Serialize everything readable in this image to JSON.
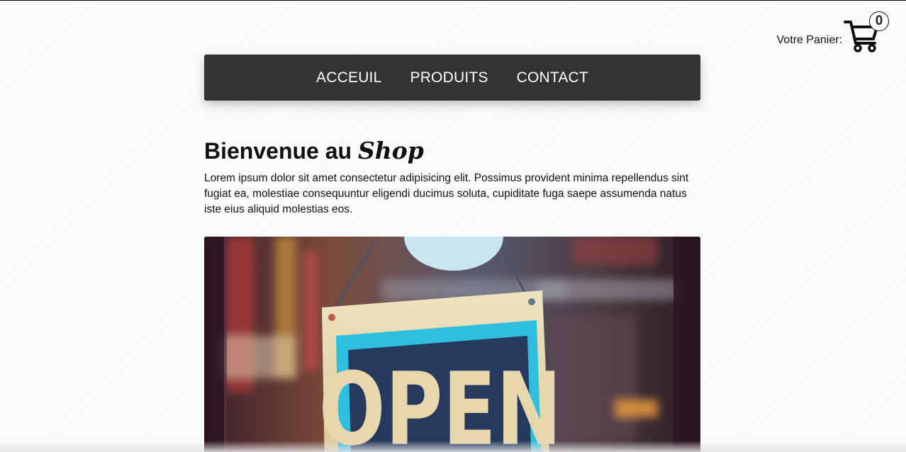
{
  "cart": {
    "label": "Votre Panier:",
    "count": "0",
    "icon": "shopping-cart-icon"
  },
  "nav": {
    "items": [
      {
        "label": "ACCEUIL"
      },
      {
        "label": "PRODUITS"
      },
      {
        "label": "CONTACT"
      }
    ]
  },
  "main": {
    "title_prefix": "Bienvenue au",
    "title_brand": "Shop",
    "intro": "Lorem ipsum dolor sit amet consectetur adipisicing elit. Possimus provident minima repellendus sint fugiat ea, molestiae consequuntur eligendi ducimus soluta, cupiditate fuga saepe assumenda natus iste eius aliquid molestias eos."
  },
  "hero": {
    "sign_text": "OPEN"
  },
  "colors": {
    "nav_background": "#333333",
    "sign_blue": "#2ebfe0",
    "sign_board": "#e8d7ad",
    "sign_letters": "#263a5e"
  }
}
